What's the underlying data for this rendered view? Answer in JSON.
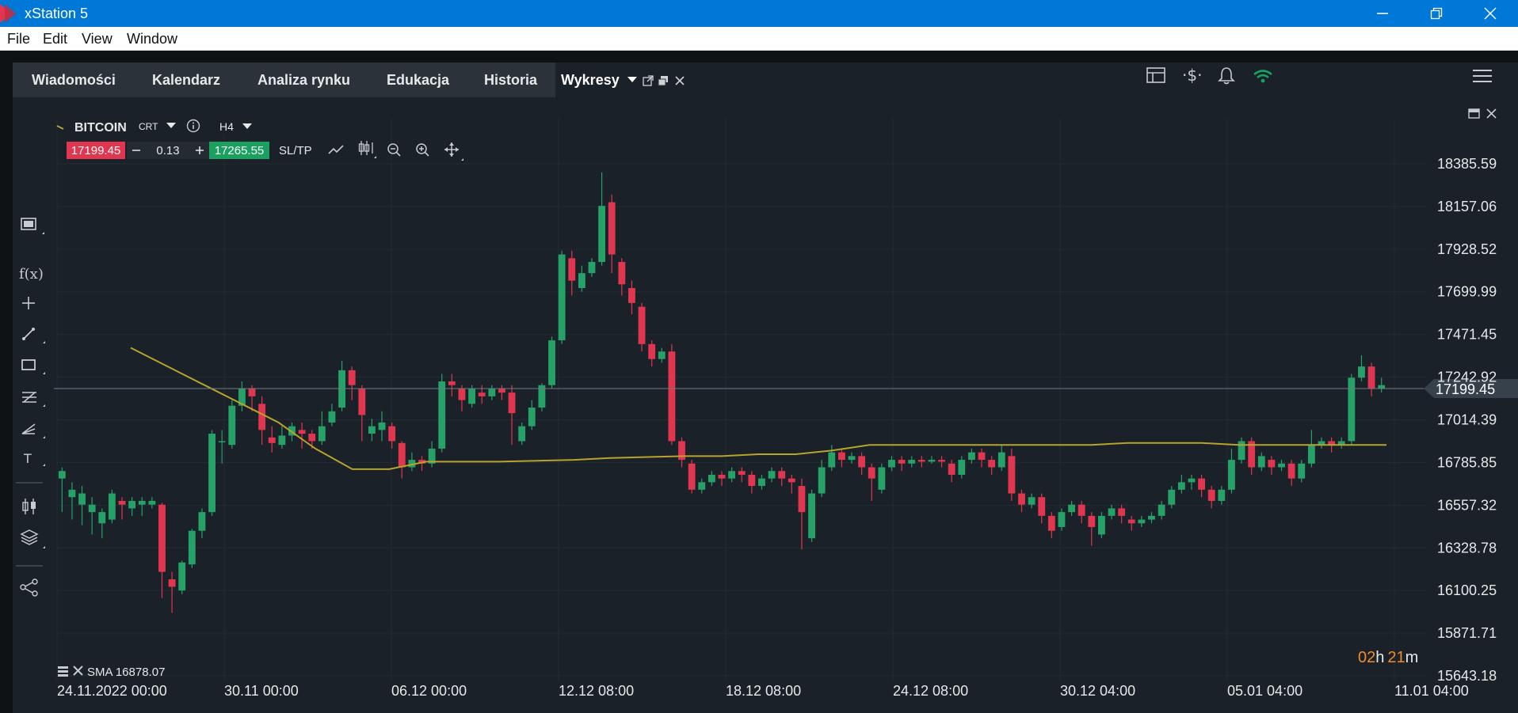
{
  "window": {
    "title": "xStation 5"
  },
  "menu": [
    "File",
    "Edit",
    "View",
    "Window"
  ],
  "tabs": [
    {
      "label": "Wiadomości"
    },
    {
      "label": "Kalendarz"
    },
    {
      "label": "Analiza rynku"
    },
    {
      "label": "Edukacja"
    },
    {
      "label": "Historia"
    },
    {
      "label": "Wykresy",
      "active": true
    }
  ],
  "instrument": {
    "symbol": "BITCOIN",
    "type": "CRT",
    "interval": "H4",
    "sell_price": "17199.45",
    "buy_price": "17265.55",
    "volume": "0.13",
    "sltp_label": "SL/TP"
  },
  "current_price": "17199.45",
  "indicator": {
    "label": "SMA 16878.07"
  },
  "timer": {
    "hours": "02",
    "h_unit": "h",
    "minutes": "21",
    "m_unit": "m"
  },
  "colors": {
    "up": "#26a269",
    "down": "#e0364f",
    "sma": "#b8a32c",
    "sell": "#e0364f",
    "buy": "#1aa160",
    "background": "#1a2128"
  },
  "chart_data": {
    "type": "candlestick",
    "y_ticks": [
      "18385.59",
      "18157.06",
      "17928.52",
      "17699.99",
      "17471.45",
      "17242.92",
      "17014.39",
      "16785.85",
      "16557.32",
      "16328.78",
      "16100.25",
      "15871.71",
      "15643.18"
    ],
    "x_ticks": [
      "24.11.2022 00:00",
      "30.11 00:00",
      "06.12 00:00",
      "12.12 08:00",
      "18.12 08:00",
      "24.12 08:00",
      "30.12 04:00",
      "05.01 04:00",
      "11.01 04:00"
    ],
    "ylim": [
      15643.18,
      18385.59
    ],
    "series": [
      {
        "name": "BITCOIN",
        "type": "candlestick"
      },
      {
        "name": "SMA",
        "type": "line",
        "values": [
          17400,
          17300,
          17200,
          17100,
          17000,
          16860,
          16750,
          16750,
          16790,
          16790,
          16790,
          16795,
          16800,
          16810,
          16815,
          16820,
          16820,
          16830,
          16830,
          16850,
          16880,
          16880,
          16880,
          16880,
          16880,
          16880,
          16880,
          16890,
          16890,
          16890,
          16880,
          16880,
          16880,
          16880,
          16880
        ]
      }
    ],
    "candles": [
      [
        16700,
        16740,
        16540,
        16520,
        16760
      ],
      [
        16600,
        16640,
        16520,
        16480,
        16680
      ],
      [
        16560,
        16620,
        16500,
        16450,
        16660
      ],
      [
        16520,
        16560,
        16430,
        16400,
        16600
      ],
      [
        16460,
        16520,
        16420,
        16380,
        16540
      ],
      [
        16480,
        16620,
        16470,
        16460,
        16640
      ],
      [
        16580,
        16560,
        16500,
        16480,
        16600
      ],
      [
        16540,
        16580,
        16510,
        16500,
        16600
      ],
      [
        16560,
        16580,
        16520,
        16500,
        16600
      ],
      [
        16560,
        16580,
        16560,
        16540,
        16600
      ],
      [
        16560,
        16200,
        16200,
        16060,
        16570
      ],
      [
        16160,
        16120,
        16060,
        15980,
        16200
      ],
      [
        16100,
        16250,
        16100,
        16080,
        16260
      ],
      [
        16240,
        16420,
        16240,
        16220,
        16430
      ],
      [
        16420,
        16520,
        16400,
        16380,
        16540
      ],
      [
        16520,
        16940,
        16520,
        16500,
        16960
      ],
      [
        16900,
        16900,
        16860,
        16780,
        16960
      ],
      [
        16880,
        17090,
        16880,
        16860,
        17120
      ],
      [
        17090,
        17180,
        17090,
        17060,
        17220
      ],
      [
        17180,
        17140,
        17080,
        17060,
        17200
      ],
      [
        17100,
        16960,
        16900,
        16880,
        17140
      ],
      [
        16920,
        16890,
        16860,
        16840,
        16980
      ],
      [
        16880,
        16930,
        16870,
        16860,
        16980
      ],
      [
        16930,
        16980,
        16920,
        16900,
        17000
      ],
      [
        16960,
        16940,
        16900,
        16860,
        17000
      ],
      [
        16940,
        16900,
        16880,
        16860,
        16960
      ],
      [
        16900,
        16980,
        16900,
        16880,
        17060
      ],
      [
        17000,
        17060,
        17000,
        16980,
        17100
      ],
      [
        17080,
        17280,
        17080,
        17060,
        17330
      ],
      [
        17280,
        17200,
        17160,
        17120,
        17300
      ],
      [
        17180,
        17040,
        16920,
        16900,
        17200
      ],
      [
        16940,
        16980,
        16930,
        16900,
        17020
      ],
      [
        16960,
        17000,
        16940,
        16900,
        17060
      ],
      [
        16980,
        16900,
        16880,
        16860,
        17000
      ],
      [
        16890,
        16760,
        16740,
        16700,
        16900
      ],
      [
        16760,
        16800,
        16760,
        16740,
        16840
      ],
      [
        16800,
        16780,
        16760,
        16740,
        16820
      ],
      [
        16780,
        16860,
        16780,
        16760,
        16900
      ],
      [
        16860,
        17220,
        16860,
        16840,
        17260
      ],
      [
        17220,
        17200,
        17160,
        17140,
        17260
      ],
      [
        17180,
        17120,
        17080,
        17060,
        17200
      ],
      [
        17100,
        17180,
        17100,
        17080,
        17200
      ],
      [
        17160,
        17140,
        17120,
        17100,
        17200
      ],
      [
        17140,
        17180,
        17140,
        17120,
        17200
      ],
      [
        17180,
        17160,
        17140,
        17120,
        17200
      ],
      [
        17160,
        17050,
        16900,
        16880,
        17200
      ],
      [
        16900,
        16980,
        16900,
        16880,
        17000
      ],
      [
        16980,
        17080,
        16980,
        16960,
        17120
      ],
      [
        17080,
        17200,
        17080,
        17060,
        17210
      ],
      [
        17200,
        17440,
        17200,
        17180,
        17460
      ],
      [
        17440,
        17900,
        17440,
        17420,
        17920
      ],
      [
        17880,
        17760,
        17700,
        17680,
        17920
      ],
      [
        17720,
        17800,
        17720,
        17700,
        17840
      ],
      [
        17800,
        17860,
        17800,
        17780,
        17880
      ],
      [
        17860,
        18160,
        17860,
        17840,
        18340
      ],
      [
        18180,
        17900,
        17840,
        17800,
        18220
      ],
      [
        17860,
        17740,
        17700,
        17680,
        17880
      ],
      [
        17720,
        17640,
        17600,
        17580,
        17760
      ],
      [
        17620,
        17420,
        17400,
        17380,
        17640
      ],
      [
        17420,
        17340,
        17320,
        17300,
        17440
      ],
      [
        17340,
        17380,
        17340,
        17320,
        17400
      ],
      [
        17380,
        16900,
        16900,
        16880,
        17420
      ],
      [
        16900,
        16800,
        16780,
        16760,
        16920
      ],
      [
        16780,
        16640,
        16640,
        16620,
        16800
      ],
      [
        16640,
        16680,
        16640,
        16620,
        16700
      ],
      [
        16680,
        16720,
        16680,
        16660,
        16740
      ],
      [
        16720,
        16700,
        16680,
        16660,
        16740
      ],
      [
        16700,
        16740,
        16700,
        16680,
        16760
      ],
      [
        16740,
        16720,
        16700,
        16680,
        16760
      ],
      [
        16720,
        16660,
        16640,
        16620,
        16740
      ],
      [
        16660,
        16700,
        16660,
        16640,
        16720
      ],
      [
        16700,
        16740,
        16700,
        16680,
        16760
      ],
      [
        16740,
        16700,
        16680,
        16660,
        16760
      ],
      [
        16700,
        16680,
        16640,
        16620,
        16720
      ],
      [
        16660,
        16520,
        16380,
        16320,
        16700
      ],
      [
        16380,
        16620,
        16380,
        16360,
        16640
      ],
      [
        16620,
        16760,
        16620,
        16600,
        16800
      ],
      [
        16760,
        16840,
        16760,
        16740,
        16880
      ],
      [
        16840,
        16800,
        16780,
        16760,
        16860
      ],
      [
        16800,
        16820,
        16790,
        16780,
        16840
      ],
      [
        16820,
        16760,
        16740,
        16720,
        16840
      ],
      [
        16760,
        16700,
        16600,
        16580,
        16780
      ],
      [
        16640,
        16760,
        16640,
        16620,
        16780
      ],
      [
        16760,
        16800,
        16760,
        16740,
        16820
      ],
      [
        16800,
        16780,
        16760,
        16740,
        16820
      ],
      [
        16780,
        16800,
        16780,
        16760,
        16820
      ],
      [
        16800,
        16790,
        16770,
        16760,
        16820
      ],
      [
        16790,
        16800,
        16790,
        16780,
        16820
      ],
      [
        16800,
        16790,
        16780,
        16760,
        16820
      ],
      [
        16780,
        16720,
        16700,
        16680,
        16800
      ],
      [
        16720,
        16800,
        16720,
        16700,
        16820
      ],
      [
        16800,
        16840,
        16800,
        16780,
        16860
      ],
      [
        16840,
        16800,
        16780,
        16760,
        16860
      ],
      [
        16800,
        16760,
        16740,
        16720,
        16820
      ],
      [
        16760,
        16840,
        16760,
        16740,
        16880
      ],
      [
        16820,
        16620,
        16600,
        16580,
        16860
      ],
      [
        16620,
        16560,
        16540,
        16520,
        16640
      ],
      [
        16560,
        16600,
        16560,
        16540,
        16620
      ],
      [
        16600,
        16500,
        16480,
        16460,
        16620
      ],
      [
        16500,
        16420,
        16400,
        16380,
        16520
      ],
      [
        16440,
        16520,
        16440,
        16420,
        16540
      ],
      [
        16520,
        16560,
        16520,
        16500,
        16580
      ],
      [
        16560,
        16500,
        16480,
        16460,
        16580
      ],
      [
        16500,
        16440,
        16360,
        16340,
        16520
      ],
      [
        16400,
        16500,
        16400,
        16380,
        16520
      ],
      [
        16500,
        16540,
        16500,
        16480,
        16560
      ],
      [
        16540,
        16500,
        16480,
        16460,
        16560
      ],
      [
        16480,
        16460,
        16440,
        16420,
        16500
      ],
      [
        16460,
        16480,
        16460,
        16440,
        16500
      ],
      [
        16480,
        16500,
        16480,
        16460,
        16520
      ],
      [
        16500,
        16560,
        16500,
        16480,
        16580
      ],
      [
        16560,
        16640,
        16560,
        16540,
        16660
      ],
      [
        16640,
        16680,
        16640,
        16620,
        16720
      ],
      [
        16680,
        16700,
        16660,
        16640,
        16720
      ],
      [
        16700,
        16640,
        16620,
        16600,
        16720
      ],
      [
        16640,
        16580,
        16560,
        16540,
        16660
      ],
      [
        16580,
        16640,
        16580,
        16560,
        16660
      ],
      [
        16640,
        16800,
        16640,
        16620,
        16860
      ],
      [
        16800,
        16900,
        16800,
        16780,
        16920
      ],
      [
        16900,
        16760,
        16740,
        16720,
        16920
      ],
      [
        16760,
        16820,
        16760,
        16740,
        16840
      ],
      [
        16800,
        16760,
        16740,
        16720,
        16820
      ],
      [
        16760,
        16780,
        16760,
        16740,
        16800
      ],
      [
        16780,
        16700,
        16680,
        16660,
        16800
      ],
      [
        16700,
        16780,
        16700,
        16680,
        16800
      ],
      [
        16780,
        16880,
        16780,
        16760,
        16960
      ],
      [
        16880,
        16900,
        16880,
        16860,
        16920
      ],
      [
        16900,
        16880,
        16860,
        16840,
        16920
      ],
      [
        16880,
        16900,
        16880,
        16860,
        16920
      ],
      [
        16900,
        17240,
        16900,
        16880,
        17260
      ],
      [
        17240,
        17300,
        17240,
        17220,
        17360
      ],
      [
        17300,
        17180,
        17160,
        17140,
        17320
      ],
      [
        17180,
        17200,
        17180,
        17160,
        17240
      ]
    ]
  }
}
